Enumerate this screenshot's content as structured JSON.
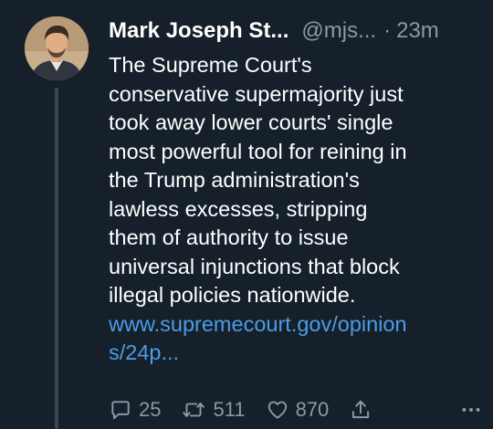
{
  "tweet": {
    "author_name": "Mark Joseph St...",
    "handle": "@mjs...",
    "separator": "·",
    "time": "23m",
    "text_lines": [
      "The Supreme Court's",
      "conservative supermajority just",
      "took away lower courts' single",
      "most powerful tool for reining in",
      "the Trump administration's",
      "lawless excesses, stripping",
      "them of authority to issue",
      "universal injunctions that block",
      "illegal policies nationwide."
    ],
    "link_lines": [
      "www.supremecourt.gov/opinion",
      "s/24p..."
    ]
  },
  "actions": {
    "replies": "25",
    "retweets": "511",
    "likes": "870"
  },
  "icons": {
    "reply": "reply-icon",
    "retweet": "retweet-icon",
    "like": "heart-icon",
    "share": "share-icon",
    "more": "more-icon"
  },
  "colors": {
    "background": "#15202b",
    "text": "#ffffff",
    "muted": "#8899a6",
    "link": "#4c9ce6",
    "thread_line": "#3a4653"
  }
}
